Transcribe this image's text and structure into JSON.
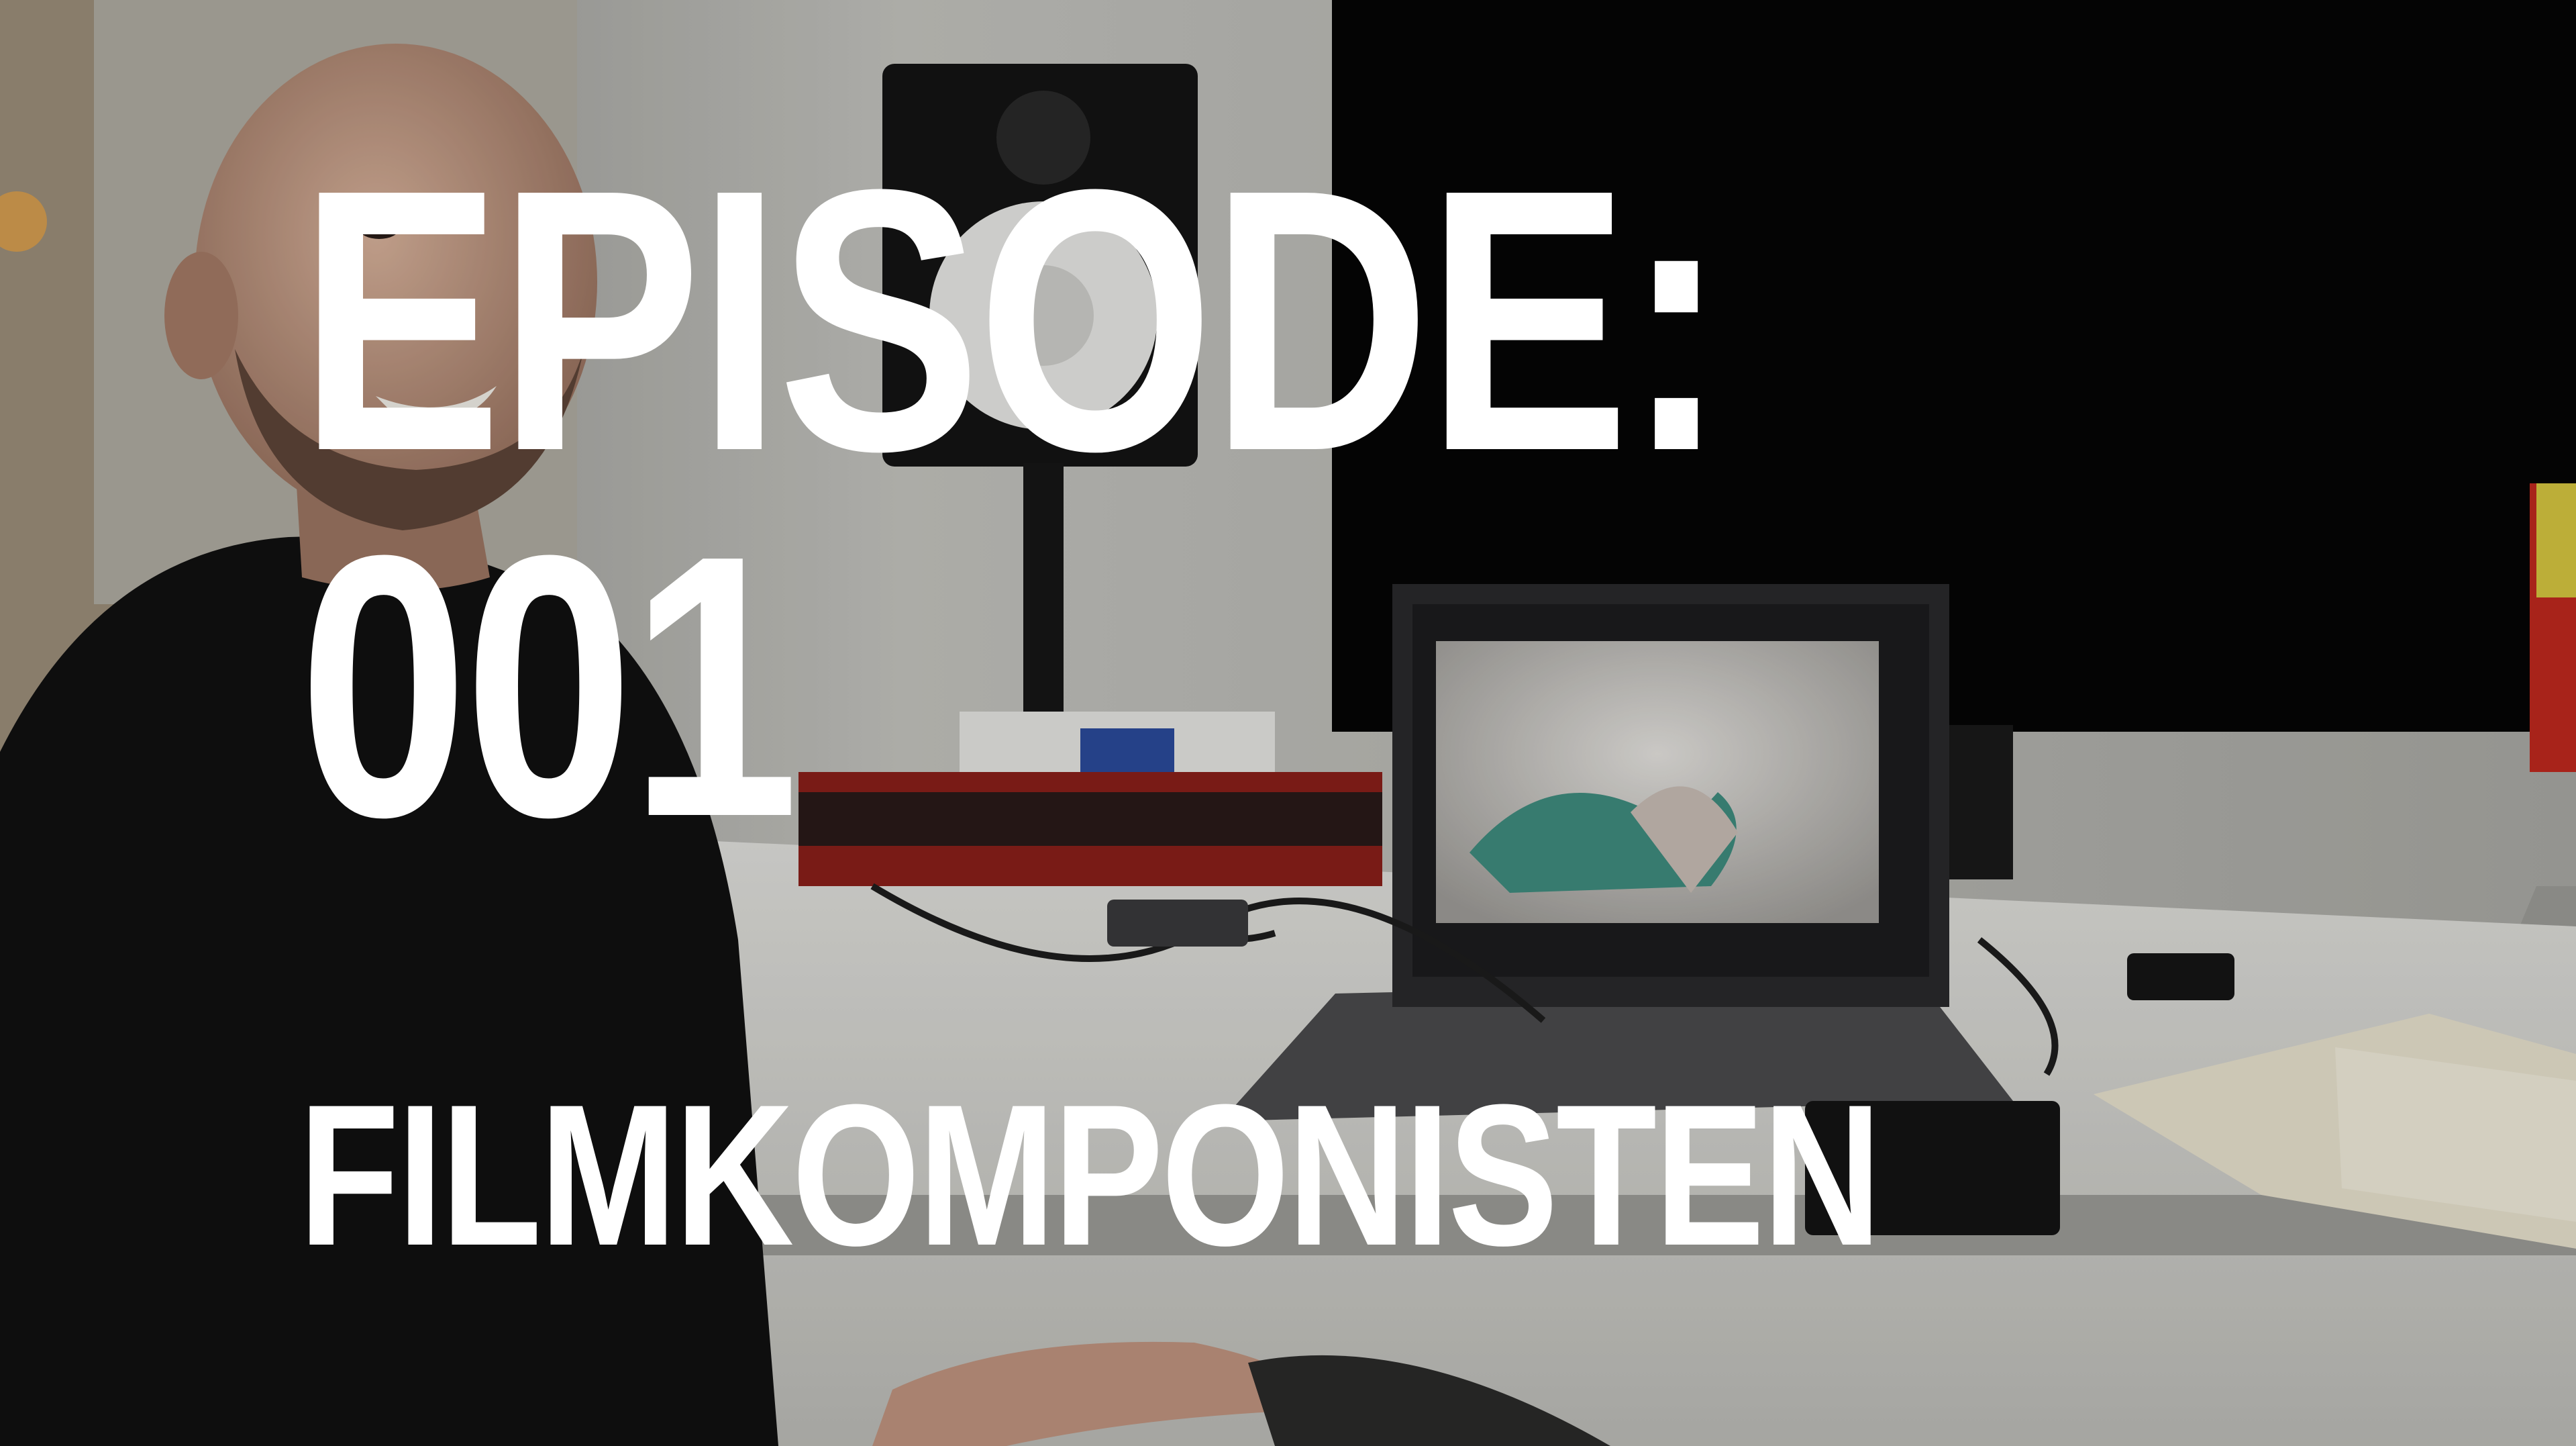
{
  "overlay": {
    "line1": "EPISODE:",
    "line2": "001",
    "line3": "FILMKOMPONISTEN"
  },
  "colors": {
    "overlay_text": "#ffffff",
    "background": "#0a0a0a",
    "wall": "#b9b9b4",
    "desk": "#d8d8d4",
    "tv": "#050505",
    "accent_red": "#c0281e"
  },
  "scene_elements": [
    "man-in-black-sweater",
    "studio-monitor-speaker",
    "audio-interface",
    "laptop",
    "tv-screen",
    "desk",
    "notebook",
    "lava-lamp"
  ]
}
